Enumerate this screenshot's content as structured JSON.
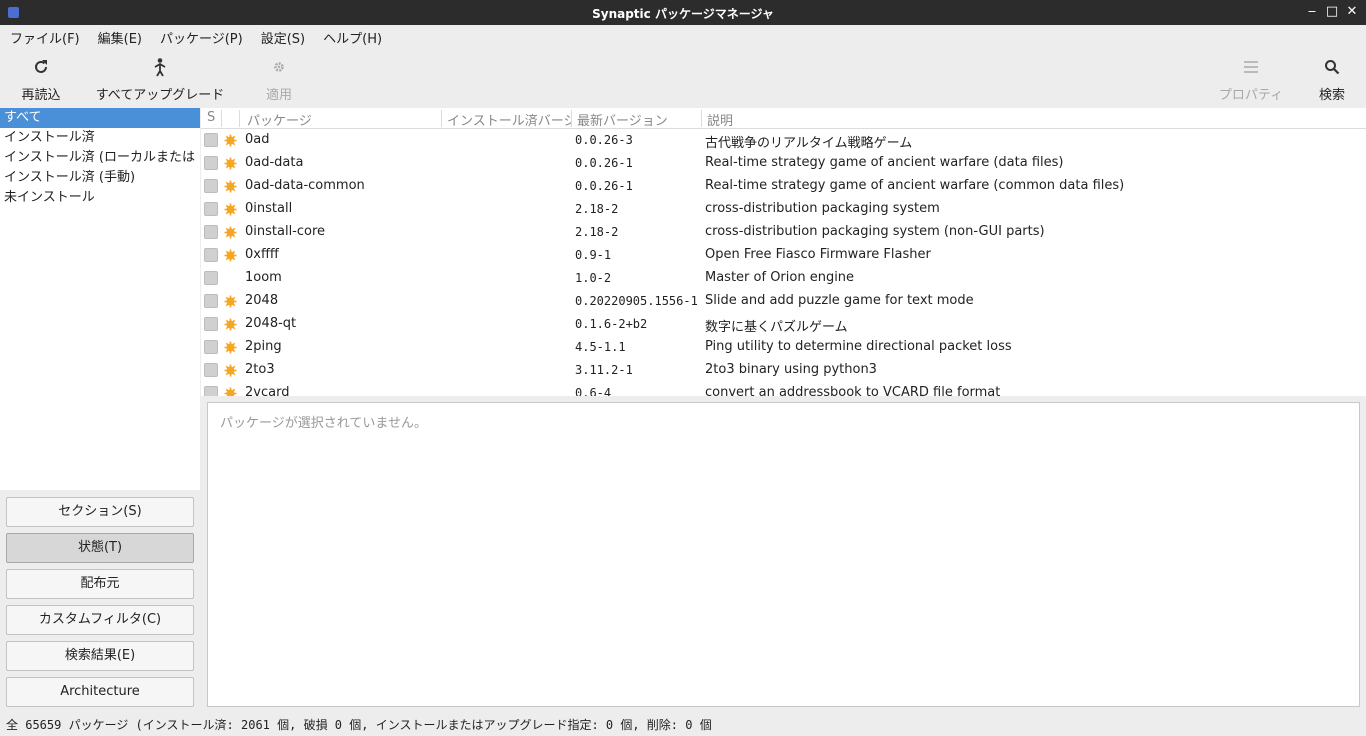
{
  "window": {
    "title": "Synaptic パッケージマネージャ",
    "controls": [
      "‒",
      "□",
      "✕"
    ]
  },
  "menu": [
    "ファイル(F)",
    "編集(E)",
    "パッケージ(P)",
    "設定(S)",
    "ヘルプ(H)"
  ],
  "toolbar": {
    "reload": "再読込",
    "mark_all_upgrades": "すべてアップグレード",
    "apply": "適用",
    "properties": "プロパティ",
    "search": "検索"
  },
  "sidebar": {
    "filters": [
      "すべて",
      "インストール済",
      "インストール済 (ローカルまたは",
      "インストール済 (手動)",
      "未インストール"
    ],
    "buttons": [
      "セクション(S)",
      "状態(T)",
      "配布元",
      "カスタムフィルタ(C)",
      "検索結果(E)",
      "Architecture"
    ]
  },
  "table": {
    "headers": {
      "s": "S",
      "package": "パッケージ",
      "installed": "インストール済バージ",
      "latest": "最新バージョン",
      "description": "説明"
    },
    "rows": [
      {
        "name": "0ad",
        "version": "0.0.26-3",
        "desc": "古代戦争のリアルタイム戦略ゲーム",
        "supported": true
      },
      {
        "name": "0ad-data",
        "version": "0.0.26-1",
        "desc": "Real-time strategy game of ancient warfare (data files)",
        "supported": true
      },
      {
        "name": "0ad-data-common",
        "version": "0.0.26-1",
        "desc": "Real-time strategy game of ancient warfare (common data files)",
        "supported": true
      },
      {
        "name": "0install",
        "version": "2.18-2",
        "desc": "cross-distribution packaging system",
        "supported": true
      },
      {
        "name": "0install-core",
        "version": "2.18-2",
        "desc": "cross-distribution packaging system (non-GUI parts)",
        "supported": true
      },
      {
        "name": "0xffff",
        "version": "0.9-1",
        "desc": "Open Free Fiasco Firmware Flasher",
        "supported": true
      },
      {
        "name": "1oom",
        "version": "1.0-2",
        "desc": "Master of Orion engine",
        "supported": false
      },
      {
        "name": "2048",
        "version": "0.20220905.1556-1",
        "desc": "Slide and add puzzle game for text mode",
        "supported": true
      },
      {
        "name": "2048-qt",
        "version": "0.1.6-2+b2",
        "desc": "数字に基くパズルゲーム",
        "supported": true
      },
      {
        "name": "2ping",
        "version": "4.5-1.1",
        "desc": "Ping utility to determine directional packet loss",
        "supported": true
      },
      {
        "name": "2to3",
        "version": "3.11.2-1",
        "desc": "2to3 binary using python3",
        "supported": true
      },
      {
        "name": "2vcard",
        "version": "0.6-4",
        "desc": "convert an addressbook to VCARD file format",
        "supported": true
      }
    ]
  },
  "details": {
    "placeholder": "パッケージが選択されていません。"
  },
  "status": "全 65659 パッケージ (インストール済: 2061 個, 破損 0 個, インストールまたはアップグレード指定: 0 個, 削除: 0 個",
  "colors": {
    "selection": "#4a90d9",
    "support_badge": "#f5a623",
    "titlebar": "#2c2c2c"
  }
}
